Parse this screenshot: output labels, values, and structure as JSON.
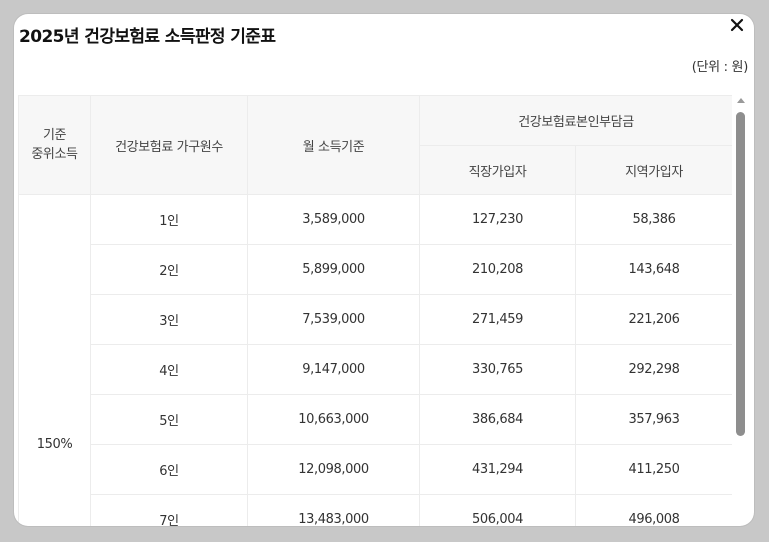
{
  "dialog": {
    "title": "2025년 건강보험료 소득판정 기준표",
    "unit": "(단위 : 원)",
    "close_symbol": "✕"
  },
  "table": {
    "headers": {
      "level": "기준\n중위소득",
      "household": "건강보험료 가구원수",
      "monthly_income": "월 소득기준",
      "premium_group": "건강보험료본인부담금",
      "employee": "직장가입자",
      "regional": "지역가입자"
    },
    "level_value": "150%",
    "rows": [
      {
        "household": "1인",
        "income": "3,589,000",
        "employee": "127,230",
        "regional": "58,386"
      },
      {
        "household": "2인",
        "income": "5,899,000",
        "employee": "210,208",
        "regional": "143,648"
      },
      {
        "household": "3인",
        "income": "7,539,000",
        "employee": "271,459",
        "regional": "221,206"
      },
      {
        "household": "4인",
        "income": "9,147,000",
        "employee": "330,765",
        "regional": "292,298"
      },
      {
        "household": "5인",
        "income": "10,663,000",
        "employee": "386,684",
        "regional": "357,963"
      },
      {
        "household": "6인",
        "income": "12,098,000",
        "employee": "431,294",
        "regional": "411,250"
      },
      {
        "household": "7인",
        "income": "13,483,000",
        "employee": "506,004",
        "regional": "496,008"
      }
    ]
  }
}
